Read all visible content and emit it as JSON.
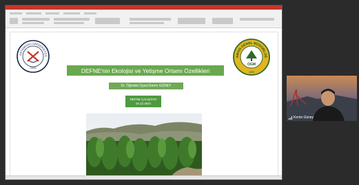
{
  "slide": {
    "left_logo_text": "KASTAMONU ÜNİVERSİTESİ",
    "left_logo_year": "2006",
    "right_logo_text": "ORMAN GENEL MÜDÜRLÜĞÜ",
    "right_logo_abbr": "OGM",
    "right_logo_year": "1839",
    "title": "DEFNE'nin Ekolojisi ve Yetişme Ortamı Özellikleri",
    "author": "Dr. Öğretim Üyesi Kerim GÜNEY",
    "event": "DEFNE ÇALIŞTAYI",
    "date": "15.12.2021"
  },
  "participant": {
    "name": "Kerim Güney"
  },
  "colors": {
    "title_bg": "#69a84f",
    "date_bg": "#4f9a3f",
    "accent_red": "#c8352b"
  }
}
